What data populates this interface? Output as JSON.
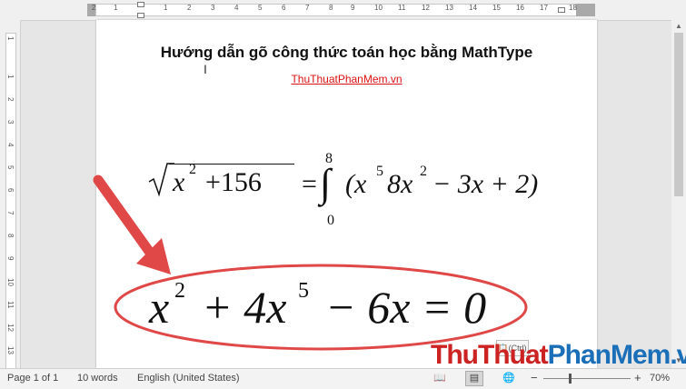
{
  "ruler": {
    "top_ticks": [
      "2",
      "1",
      "1",
      "2",
      "3",
      "4",
      "5",
      "6",
      "7",
      "8",
      "9",
      "10",
      "11",
      "12",
      "13",
      "14",
      "15",
      "16",
      "17",
      "18"
    ],
    "left_ticks": [
      "1",
      "1",
      "2",
      "3",
      "4",
      "5",
      "6",
      "7",
      "8",
      "9",
      "10",
      "11",
      "12",
      "13"
    ]
  },
  "document": {
    "title": "Hướng dẫn gõ công thức toán học bằng MathType",
    "link": "ThuThuatPhanMem.vn",
    "eq1": {
      "sqrt_inner": "x",
      "exp2": "2",
      "plus156": "+156",
      "equals": "=",
      "integral": "∫",
      "upper": "8",
      "lower": "0",
      "body_open": "(x",
      "exp5": "5",
      "mid": "8x",
      "exp2b": "2",
      "tail": "− 3x + 2)"
    },
    "eq2": {
      "x1": "x",
      "exp2": "2",
      "mid": "+ 4x",
      "exp5": "5",
      "tail": "− 6x = 0"
    }
  },
  "status": {
    "page": "Page 1 of 1",
    "words": "10 words",
    "language": "English (United States)",
    "zoom_minus": "−",
    "zoom_plus": "+",
    "zoom": "70%"
  },
  "watermark": {
    "part1": "ThuThuat",
    "part2": "PhanMem",
    "part3": ".vn",
    "color1": "#cc2222",
    "color2": "#1a6fb8"
  },
  "annotation": {
    "color": "#e04848"
  },
  "paste_hint": "(Ctrl)"
}
